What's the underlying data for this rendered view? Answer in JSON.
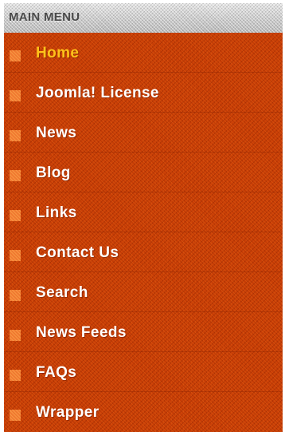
{
  "menu": {
    "title": "MAIN MENU",
    "items": [
      {
        "label": "Home",
        "active": true
      },
      {
        "label": "Joomla! License",
        "active": false
      },
      {
        "label": "News",
        "active": false
      },
      {
        "label": "Blog",
        "active": false
      },
      {
        "label": "Links",
        "active": false
      },
      {
        "label": "Contact Us",
        "active": false
      },
      {
        "label": "Search",
        "active": false
      },
      {
        "label": "News Feeds",
        "active": false
      },
      {
        "label": "FAQs",
        "active": false
      },
      {
        "label": "Wrapper",
        "active": false
      }
    ]
  },
  "colors": {
    "panel_background": "#c63c05",
    "header_background": "#cfcfcf",
    "label_text": "#ffffff",
    "active_label_text": "#ffc21a",
    "bullet": "#f07830"
  },
  "icons": {
    "item_bullet": "square-bullet-icon"
  }
}
